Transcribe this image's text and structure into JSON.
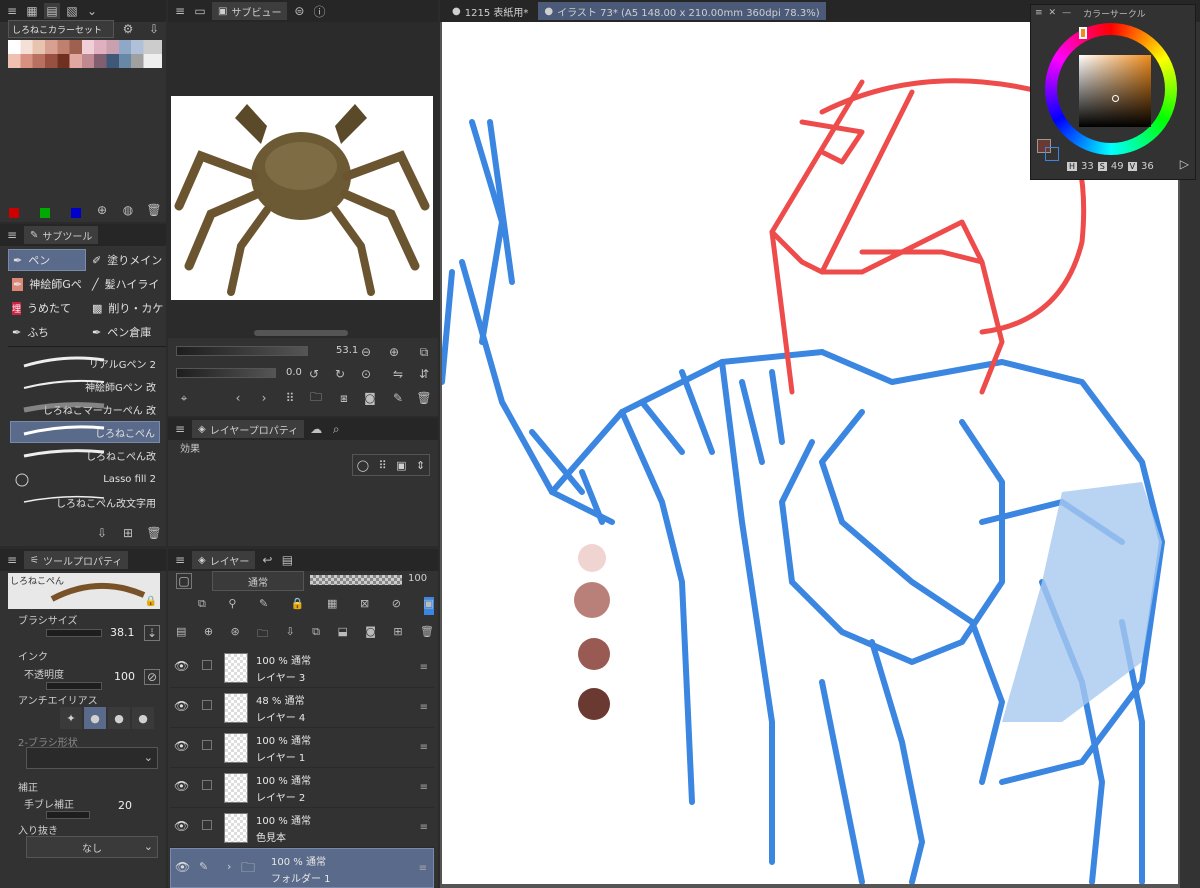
{
  "color_set": {
    "name": "しろねこカラーセット"
  },
  "subview": {
    "title": "サブビュー"
  },
  "subview_controls": {
    "zoom": "53.1",
    "rotate": "0.0"
  },
  "subtool": {
    "title": "サブツール",
    "groups": [
      {
        "label": "ペン"
      },
      {
        "label": "塗りメイン"
      },
      {
        "label": "神絵師Gペ"
      },
      {
        "label": "髪ハイライ"
      },
      {
        "label": "うめたて"
      },
      {
        "label": "削り・カケ"
      },
      {
        "label": "ふち"
      },
      {
        "label": "ペン倉庫"
      }
    ],
    "brushes": [
      {
        "label": "リアルGペン 2"
      },
      {
        "label": "神絵師Gペン 改"
      },
      {
        "label": "しろねこマーカーぺん 改"
      },
      {
        "label": "しろねこぺん"
      },
      {
        "label": "しろねこぺん改"
      },
      {
        "label": "Lasso fill 2"
      },
      {
        "label": "しろねこぺん改文字用"
      }
    ]
  },
  "layer_property": {
    "title": "レイヤープロパティ",
    "effect_label": "効果"
  },
  "tool_property": {
    "title": "ツールプロパティ",
    "brush_name": "しろねこぺん",
    "brush_size_label": "ブラシサイズ",
    "brush_size": "38.1",
    "ink_label": "インク",
    "opacity_label": "不透明度",
    "opacity": "100",
    "antialias_label": "アンチエイリアス",
    "brush_shape_label": "2-ブラシ形状",
    "correction_label": "補正",
    "stabilization_label": "手ブレ補正",
    "stabilization": "20",
    "taper_label": "入り抜き",
    "taper_value": "なし"
  },
  "layer_panel": {
    "title": "レイヤー",
    "blend_mode": "通常",
    "opacity": "100",
    "layers": [
      {
        "pct": "100 %",
        "mode": "通常",
        "name": "レイヤー 3"
      },
      {
        "pct": "48 %",
        "mode": "通常",
        "name": "レイヤー 4"
      },
      {
        "pct": "100 %",
        "mode": "通常",
        "name": "レイヤー 1"
      },
      {
        "pct": "100 %",
        "mode": "通常",
        "name": "レイヤー 2"
      },
      {
        "pct": "100 %",
        "mode": "通常",
        "name": "色見本"
      },
      {
        "pct": "100 %",
        "mode": "通常",
        "name": "フォルダー 1"
      }
    ]
  },
  "canvas": {
    "tab1": "1215 表紙用*",
    "tab2": "イラスト 73* (A5 148.00 x 210.00mm 360dpi 78.3%)"
  },
  "color_circle": {
    "title": "カラーサークル",
    "h_label": "H",
    "h": "33",
    "s_label": "S",
    "s": "49",
    "v_label": "V",
    "v": "36"
  },
  "colors": {
    "blue_line": "#3a86e0",
    "red_line": "#ee4b4b",
    "accent": "#5a6a8a"
  }
}
